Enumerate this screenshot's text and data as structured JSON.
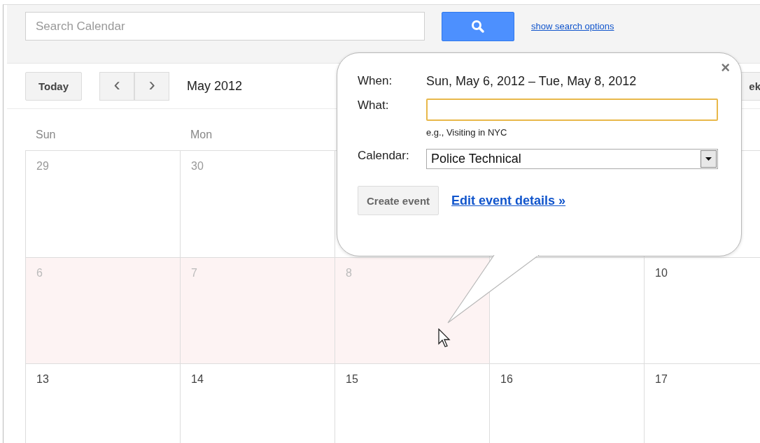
{
  "search": {
    "placeholder": "Search Calendar",
    "options_link": "show search options"
  },
  "toolbar": {
    "today": "Today",
    "prev": "‹",
    "next": "›",
    "month": "May 2012",
    "view_button": "ek"
  },
  "weekdays": [
    "Sun",
    "Mon"
  ],
  "weeks": [
    [
      {
        "day": "29",
        "muted": true,
        "selected": false
      },
      {
        "day": "30",
        "muted": true,
        "selected": false
      }
    ],
    [
      {
        "day": "6",
        "muted": false,
        "selected": true
      },
      {
        "day": "7",
        "muted": false,
        "selected": true
      },
      {
        "day": "8",
        "muted": false,
        "selected": true
      },
      {
        "selected": false
      },
      {
        "day": "10",
        "muted": false,
        "selected": false
      }
    ],
    [
      {
        "day": "13",
        "muted": false,
        "selected": false
      },
      {
        "day": "14",
        "muted": false,
        "selected": false
      },
      {
        "day": "15",
        "muted": false,
        "selected": false
      },
      {
        "day": "16",
        "muted": false,
        "selected": false
      },
      {
        "day": "17",
        "muted": false,
        "selected": false
      }
    ]
  ],
  "popup": {
    "close": "×",
    "when_label": "When:",
    "when_value": "Sun, May 6, 2012 – Tue, May 8, 2012",
    "what_label": "What:",
    "what_hint": "e.g., Visiting in NYC",
    "calendar_label": "Calendar:",
    "calendar_value": "Police Technical",
    "create_button": "Create event",
    "details_link": "Edit event details »"
  }
}
